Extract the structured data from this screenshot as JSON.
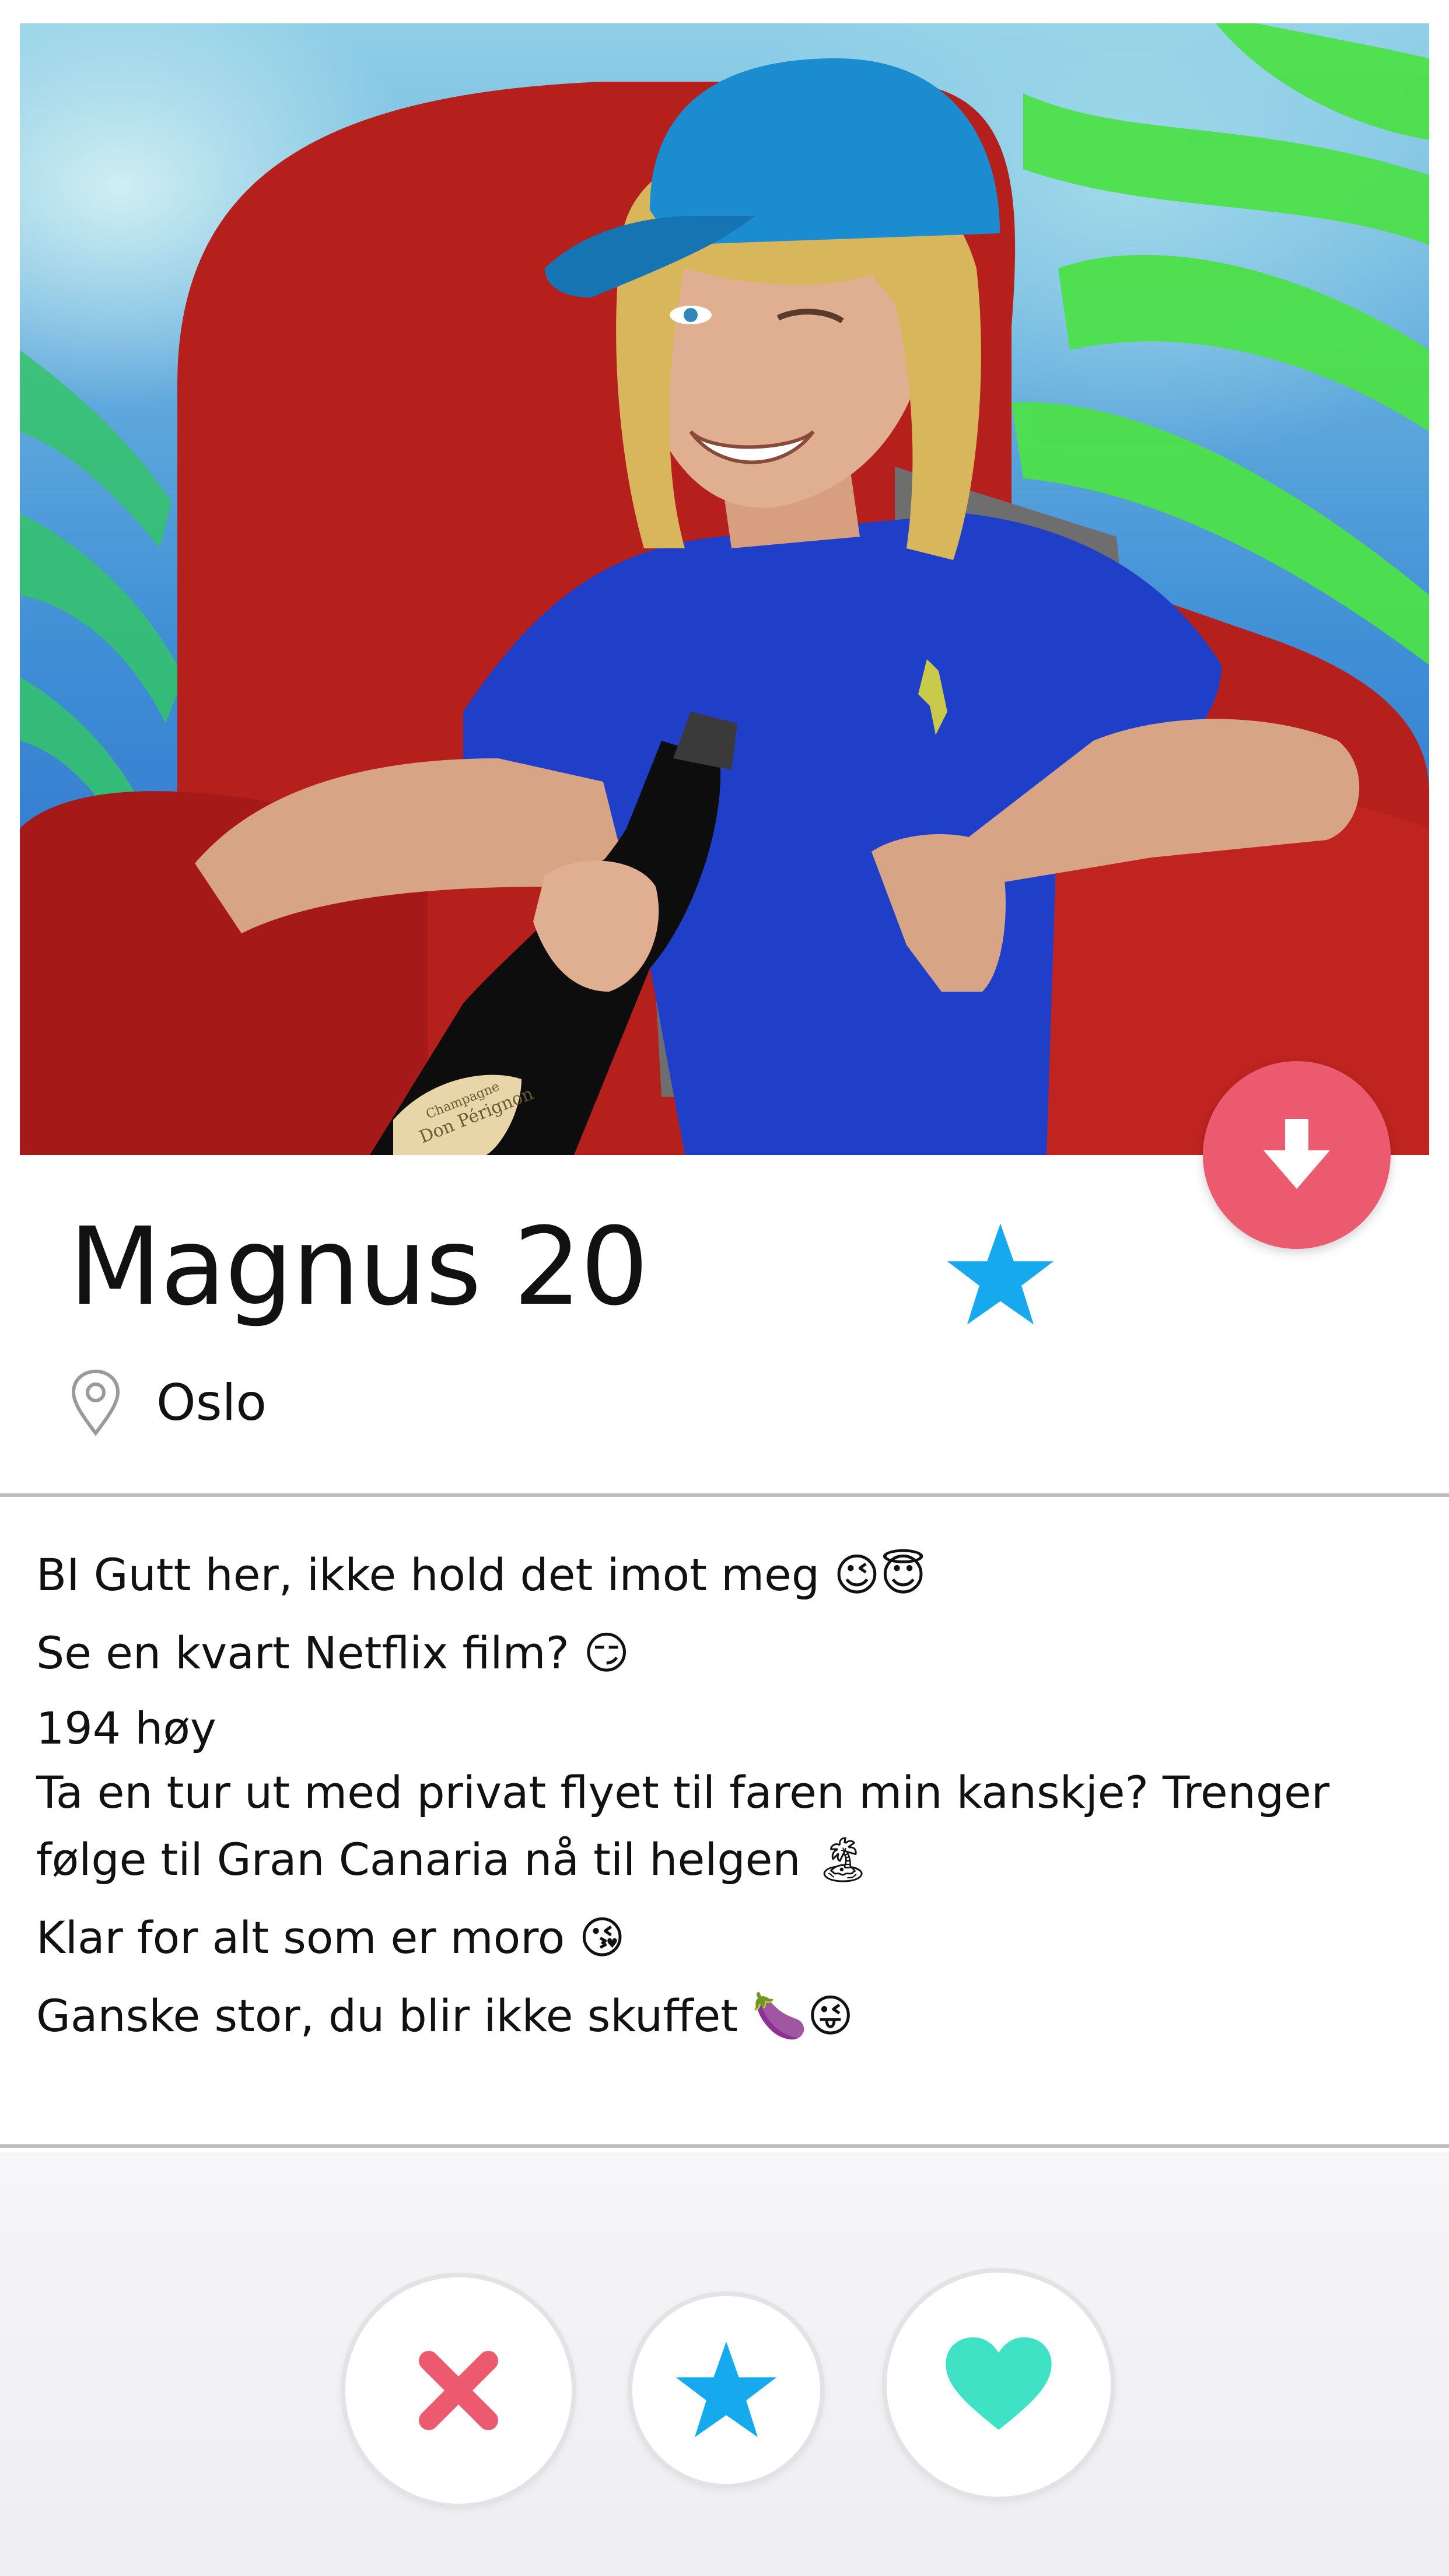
{
  "profile": {
    "name_age": "Magnus 20",
    "location": "Oslo"
  },
  "bio": {
    "lines": [
      "BI Gutt her, ikke hold det imot meg 😉😇",
      "Se en kvart Netflix film? 😏",
      "194 høy",
      "Ta en tur ut med privat flyet til faren min kanskje? Trenger",
      "følge til Gran Canaria nå til helgen 🏝",
      "Klar for alt som er moro 😘",
      "Ganske stor, du blir ikke skuffet 🍆😜"
    ]
  },
  "photo": {
    "bottle_label_line1": "Champagne",
    "bottle_label_line2": "Don Pérignon"
  },
  "icons": {
    "download": "arrow-down-icon",
    "name_star": "star-icon",
    "location": "map-pin-icon",
    "nope": "x-icon",
    "super_like": "star-icon",
    "like": "heart-icon"
  },
  "colors": {
    "download_button": "#ec5a6f",
    "nope": "#ec5a6f",
    "super_like": "#17a9ee",
    "like": "#3fe2c5",
    "divider": "#bdbdbd"
  }
}
